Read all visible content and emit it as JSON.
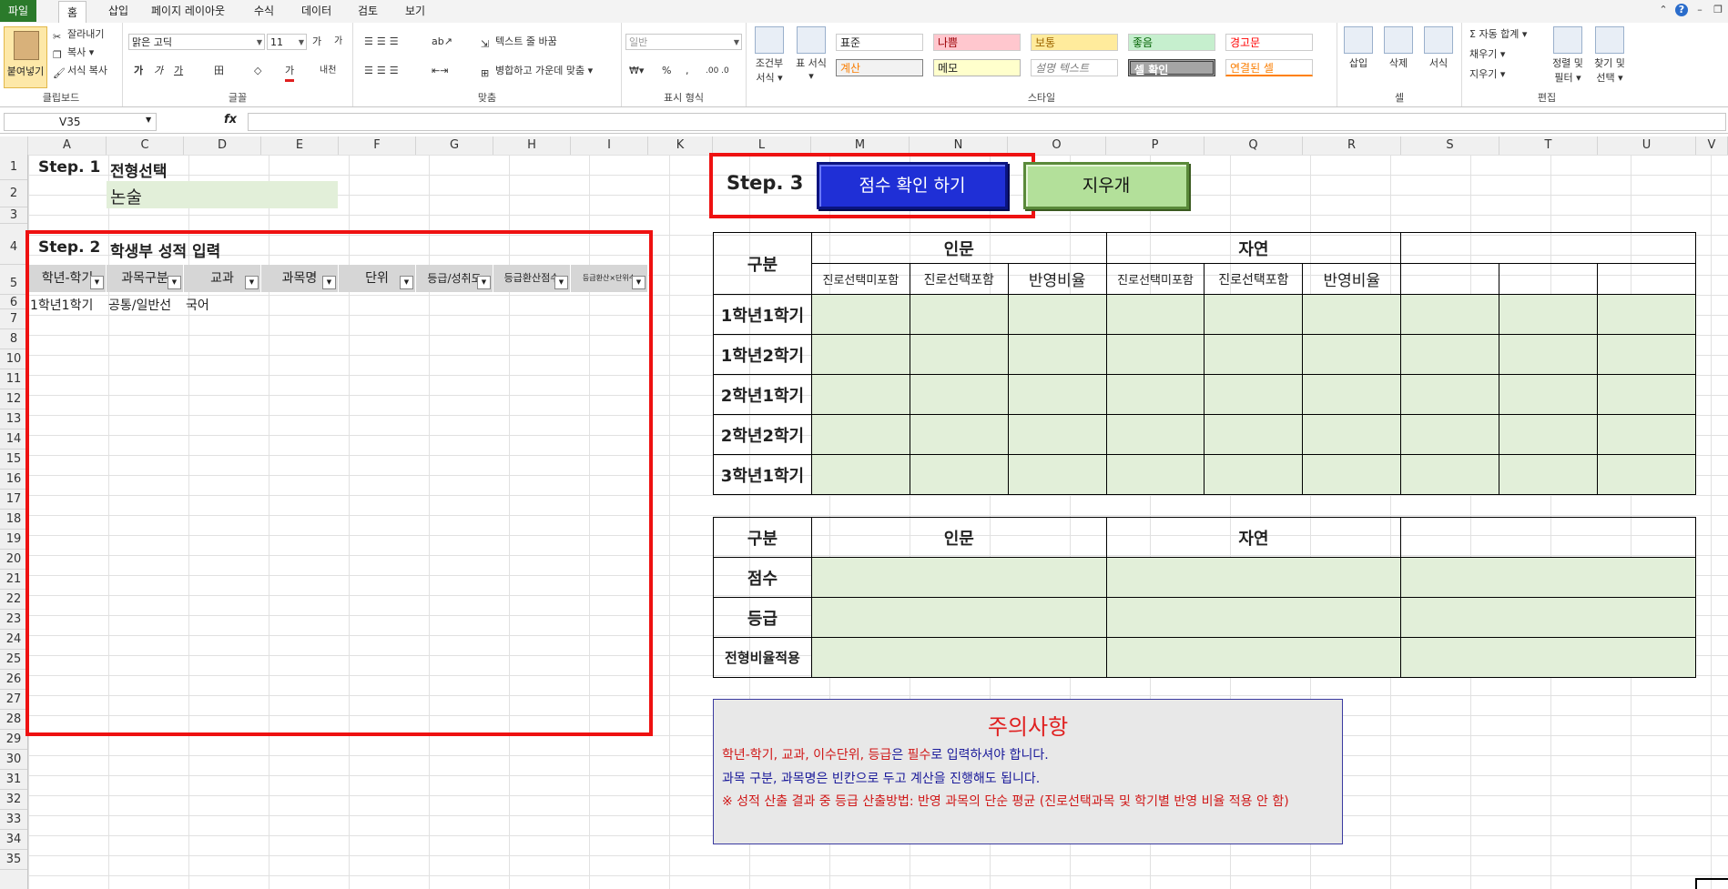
{
  "ribbon_tabs": [
    "파일",
    "홈",
    "삽입",
    "페이지 레이아웃",
    "수식",
    "데이터",
    "검토",
    "보기"
  ],
  "clipboard": {
    "paste": "붙여넣기",
    "cut": "잘라내기",
    "copy": "복사 ▾",
    "format_painter": "서식 복사",
    "label": "클립보드"
  },
  "font": {
    "name": "맑은 고딕",
    "size": "11",
    "bold": "가",
    "italic": "가",
    "underline": "가",
    "border": "田",
    "fill": "◇",
    "color": "가",
    "phonetic": "내천",
    "label": "글꼴",
    "grow": "가",
    "shrink": "가"
  },
  "alignment": {
    "wrap": "텍스트 줄 바꿈",
    "merge": "병합하고 가운데 맞춤 ▾",
    "label": "맞춤"
  },
  "number": {
    "format": "일반",
    "percent": "%",
    "comma": ",",
    "label": "표시 형식"
  },
  "styles": {
    "row1": [
      "표준",
      "나쁨",
      "보통",
      "좋음",
      "경고문"
    ],
    "row2": [
      "계산",
      "메모",
      "설명 텍스트",
      "셀 확인",
      "연결된 셀"
    ],
    "cond_format": "조건부 서식 ▾",
    "table_format": "표 서식 ▾",
    "label": "스타일"
  },
  "cells": {
    "insert": "삽입",
    "delete": "삭제",
    "format": "서식",
    "label": "셀"
  },
  "editing": {
    "autosum": "Σ 자동 합계 ▾",
    "fill": "채우기 ▾",
    "clear": "지우기 ▾",
    "sort": "정렬 및 필터 ▾",
    "find": "찾기 및 선택 ▾",
    "label": "편집"
  },
  "formula_bar": {
    "name_box": "V35",
    "fx": "fx",
    "value": ""
  },
  "columns": [
    "A",
    "C",
    "D",
    "E",
    "F",
    "G",
    "H",
    "I",
    "K",
    "L",
    "M",
    "N",
    "O",
    "P",
    "Q",
    "R",
    "S",
    "T",
    "U",
    "V"
  ],
  "rows": [
    "1",
    "2",
    "3",
    "4",
    "5",
    "6",
    "7",
    "8",
    "10",
    "11",
    "12",
    "13",
    "14",
    "15",
    "16",
    "17",
    "18",
    "19",
    "20",
    "21",
    "22",
    "23",
    "24",
    "25",
    "26",
    "27",
    "28",
    "29",
    "30",
    "31",
    "32",
    "33",
    "34",
    "35"
  ],
  "step1": {
    "label": "Step. 1",
    "title": "전형선택",
    "value": "논술"
  },
  "step2": {
    "label": "Step. 2",
    "title": "학생부 성적 입력",
    "headers": [
      "학년-학기",
      "과목구분",
      "교과",
      "과목명",
      "단위",
      "등급/성취도",
      "등급환산점수",
      "등급환산×단위수"
    ],
    "rows": [
      [
        "1학년1학기",
        "공통/일반선",
        "국어",
        "",
        "",
        "",
        "",
        ""
      ]
    ]
  },
  "step3": {
    "label": "Step. 3",
    "check_button": "점수 확인 하기",
    "clear_button": "지우개"
  },
  "table1": {
    "corner": "구분",
    "groups": [
      "인문",
      "자연",
      ""
    ],
    "subheaders": [
      "진로선택미포함",
      "진로선택포함",
      "반영비율",
      "진로선택미포함",
      "진로선택포함",
      "반영비율",
      "",
      "",
      ""
    ],
    "rows": [
      "1학년1학기",
      "1학년2학기",
      "2학년1학기",
      "2학년2학기",
      "3학년1학기"
    ]
  },
  "table2": {
    "corner": "구분",
    "groups": [
      "인문",
      "자연",
      ""
    ],
    "rows": [
      "점수",
      "등급",
      "전형비율적용"
    ]
  },
  "notice": {
    "title": "주의사항",
    "line1": {
      "a": "학년-학기, 교과, 이수단위, 등급",
      "b": "은 ",
      "c": "필수",
      "d": "로 입력하셔야 합니다."
    },
    "line2": "과목 구분, 과목명은 빈칸으로 두고 계산을 진행해도 됩니다.",
    "line3": "※ 성적 산출 결과 중 등급 산출방법: 반영 과목의 단순 평균 (진로선택과목 및 학기별 반영 비율 적용 안 함)"
  },
  "colors": {
    "accent_red": "#ee1111",
    "button_blue": "#1f2fd6",
    "button_green": "#b3e09a",
    "cell_green": "#e2efd9",
    "header_gray": "#d6d6d6"
  }
}
